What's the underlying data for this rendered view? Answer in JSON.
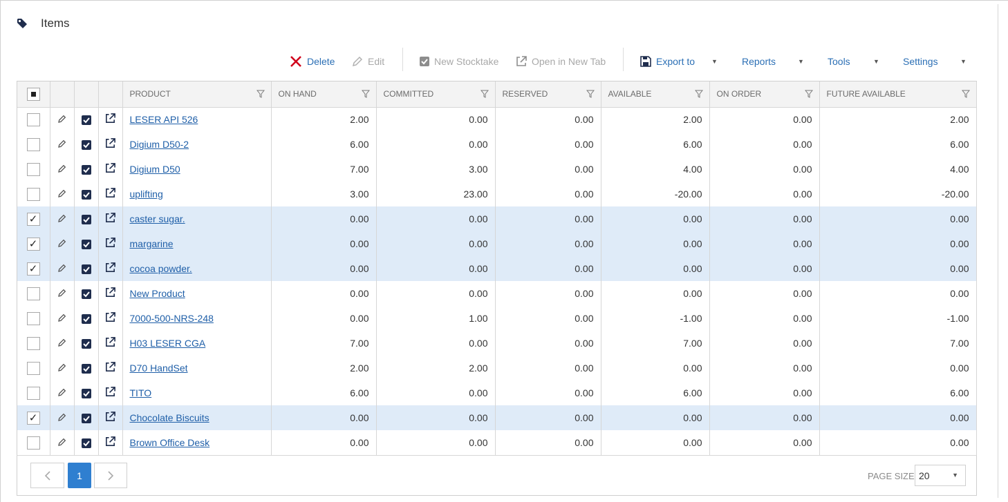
{
  "header": {
    "title": "Items",
    "icon": "tag-icon"
  },
  "toolbar": {
    "delete": "Delete",
    "edit": "Edit",
    "new_stocktake": "New Stocktake",
    "open_new_tab": "Open in New Tab",
    "export_to": "Export to",
    "reports": "Reports",
    "tools": "Tools",
    "settings": "Settings"
  },
  "columns": {
    "product": "PRODUCT",
    "on_hand": "ON HAND",
    "committed": "COMMITTED",
    "reserved": "RESERVED",
    "available": "AVAILABLE",
    "on_order": "ON ORDER",
    "future_available": "FUTURE AVAILABLE"
  },
  "rows": [
    {
      "selected": false,
      "product": "LESER API 526",
      "on_hand": "2.00",
      "committed": "0.00",
      "reserved": "0.00",
      "available": "2.00",
      "on_order": "0.00",
      "future_available": "2.00"
    },
    {
      "selected": false,
      "product": "Digium D50-2",
      "on_hand": "6.00",
      "committed": "0.00",
      "reserved": "0.00",
      "available": "6.00",
      "on_order": "0.00",
      "future_available": "6.00"
    },
    {
      "selected": false,
      "product": "Digium D50",
      "on_hand": "7.00",
      "committed": "3.00",
      "reserved": "0.00",
      "available": "4.00",
      "on_order": "0.00",
      "future_available": "4.00"
    },
    {
      "selected": false,
      "product": "uplifting",
      "on_hand": "3.00",
      "committed": "23.00",
      "reserved": "0.00",
      "available": "-20.00",
      "on_order": "0.00",
      "future_available": "-20.00"
    },
    {
      "selected": true,
      "product": "caster sugar.",
      "on_hand": "0.00",
      "committed": "0.00",
      "reserved": "0.00",
      "available": "0.00",
      "on_order": "0.00",
      "future_available": "0.00"
    },
    {
      "selected": true,
      "product": "margarine",
      "on_hand": "0.00",
      "committed": "0.00",
      "reserved": "0.00",
      "available": "0.00",
      "on_order": "0.00",
      "future_available": "0.00"
    },
    {
      "selected": true,
      "product": "cocoa powder.",
      "on_hand": "0.00",
      "committed": "0.00",
      "reserved": "0.00",
      "available": "0.00",
      "on_order": "0.00",
      "future_available": "0.00"
    },
    {
      "selected": false,
      "product": "New Product",
      "on_hand": "0.00",
      "committed": "0.00",
      "reserved": "0.00",
      "available": "0.00",
      "on_order": "0.00",
      "future_available": "0.00"
    },
    {
      "selected": false,
      "product": "7000-500-NRS-248",
      "on_hand": "0.00",
      "committed": "1.00",
      "reserved": "0.00",
      "available": "-1.00",
      "on_order": "0.00",
      "future_available": "-1.00"
    },
    {
      "selected": false,
      "product": "H03 LESER CGA",
      "on_hand": "7.00",
      "committed": "0.00",
      "reserved": "0.00",
      "available": "7.00",
      "on_order": "0.00",
      "future_available": "7.00"
    },
    {
      "selected": false,
      "product": "D70 HandSet",
      "on_hand": "2.00",
      "committed": "2.00",
      "reserved": "0.00",
      "available": "0.00",
      "on_order": "0.00",
      "future_available": "0.00"
    },
    {
      "selected": false,
      "product": "TITO",
      "on_hand": "6.00",
      "committed": "0.00",
      "reserved": "0.00",
      "available": "6.00",
      "on_order": "0.00",
      "future_available": "6.00"
    },
    {
      "selected": true,
      "product": "Chocolate Biscuits",
      "on_hand": "0.00",
      "committed": "0.00",
      "reserved": "0.00",
      "available": "0.00",
      "on_order": "0.00",
      "future_available": "0.00"
    },
    {
      "selected": false,
      "product": "Brown Office Desk",
      "on_hand": "0.00",
      "committed": "0.00",
      "reserved": "0.00",
      "available": "0.00",
      "on_order": "0.00",
      "future_available": "0.00"
    }
  ],
  "pager": {
    "current_page": "1",
    "page_size_label": "PAGE SIZE",
    "page_size": "20"
  },
  "colors": {
    "accent": "#2f7fd0",
    "link": "#1f5fa8",
    "selected_row": "#dfebf8",
    "delete": "#d0021b",
    "dark_check": "#1f2d4d"
  }
}
